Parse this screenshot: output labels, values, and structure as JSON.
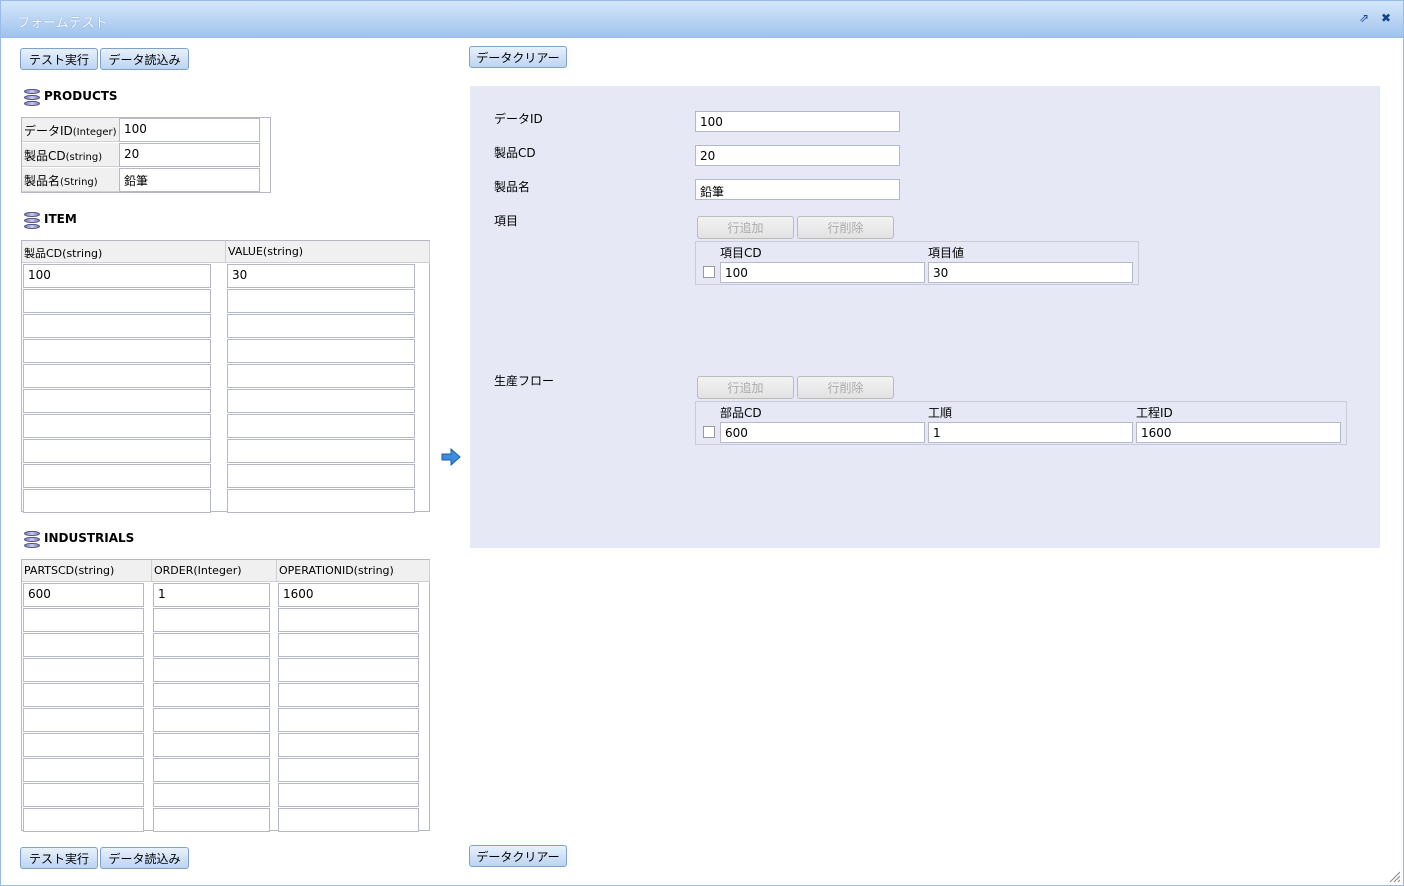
{
  "window": {
    "title": "フォームテスト",
    "restore_icon": "popout-icon",
    "close_icon": "close-icon"
  },
  "left": {
    "top_buttons": {
      "run": "テスト実行",
      "load": "データ読込み"
    },
    "bottom_buttons": {
      "run": "テスト実行",
      "load": "データ読込み"
    },
    "products": {
      "title": "PRODUCTS",
      "rows": [
        {
          "label": "データID",
          "type": "(Integer)",
          "value": "100"
        },
        {
          "label": "製品CD",
          "type": "(string)",
          "value": "20"
        },
        {
          "label": "製品名",
          "type": "(String)",
          "value": "鉛筆"
        }
      ]
    },
    "item": {
      "title": "ITEM",
      "headers": [
        "製品CD(string)",
        "VALUE(string)"
      ],
      "rows": [
        [
          "100",
          "30"
        ],
        [
          "",
          ""
        ],
        [
          "",
          ""
        ],
        [
          "",
          ""
        ],
        [
          "",
          ""
        ],
        [
          "",
          ""
        ],
        [
          "",
          ""
        ],
        [
          "",
          ""
        ],
        [
          "",
          ""
        ],
        [
          "",
          ""
        ]
      ]
    },
    "industrials": {
      "title": "INDUSTRIALS",
      "headers": [
        "PARTSCD(string)",
        "ORDER(Integer)",
        "OPERATIONID(string)"
      ],
      "rows": [
        [
          "600",
          "1",
          "1600"
        ],
        [
          "",
          "",
          ""
        ],
        [
          "",
          "",
          ""
        ],
        [
          "",
          "",
          ""
        ],
        [
          "",
          "",
          ""
        ],
        [
          "",
          "",
          ""
        ],
        [
          "",
          "",
          ""
        ],
        [
          "",
          "",
          ""
        ],
        [
          "",
          "",
          ""
        ],
        [
          "",
          "",
          ""
        ]
      ]
    }
  },
  "right": {
    "clear_top": "データクリアー",
    "clear_bottom": "データクリアー",
    "fields": {
      "data_id": {
        "label": "データID",
        "value": "100"
      },
      "product_cd": {
        "label": "製品CD",
        "value": "20"
      },
      "product_name": {
        "label": "製品名",
        "value": "鉛筆"
      }
    },
    "items": {
      "label": "項目",
      "add": "行追加",
      "delete": "行削除",
      "headers": [
        "項目CD",
        "項目値"
      ],
      "rows": [
        [
          "100",
          "30"
        ]
      ]
    },
    "flow": {
      "label": "生産フロー",
      "add": "行追加",
      "delete": "行削除",
      "headers": [
        "部品CD",
        "工順",
        "工程ID"
      ],
      "rows": [
        [
          "600",
          "1",
          "1600"
        ]
      ]
    }
  },
  "colors": {
    "title_bar": "#9fc3ee",
    "panel_bg": "#e6e9f5",
    "button": "#bcd4f2"
  }
}
